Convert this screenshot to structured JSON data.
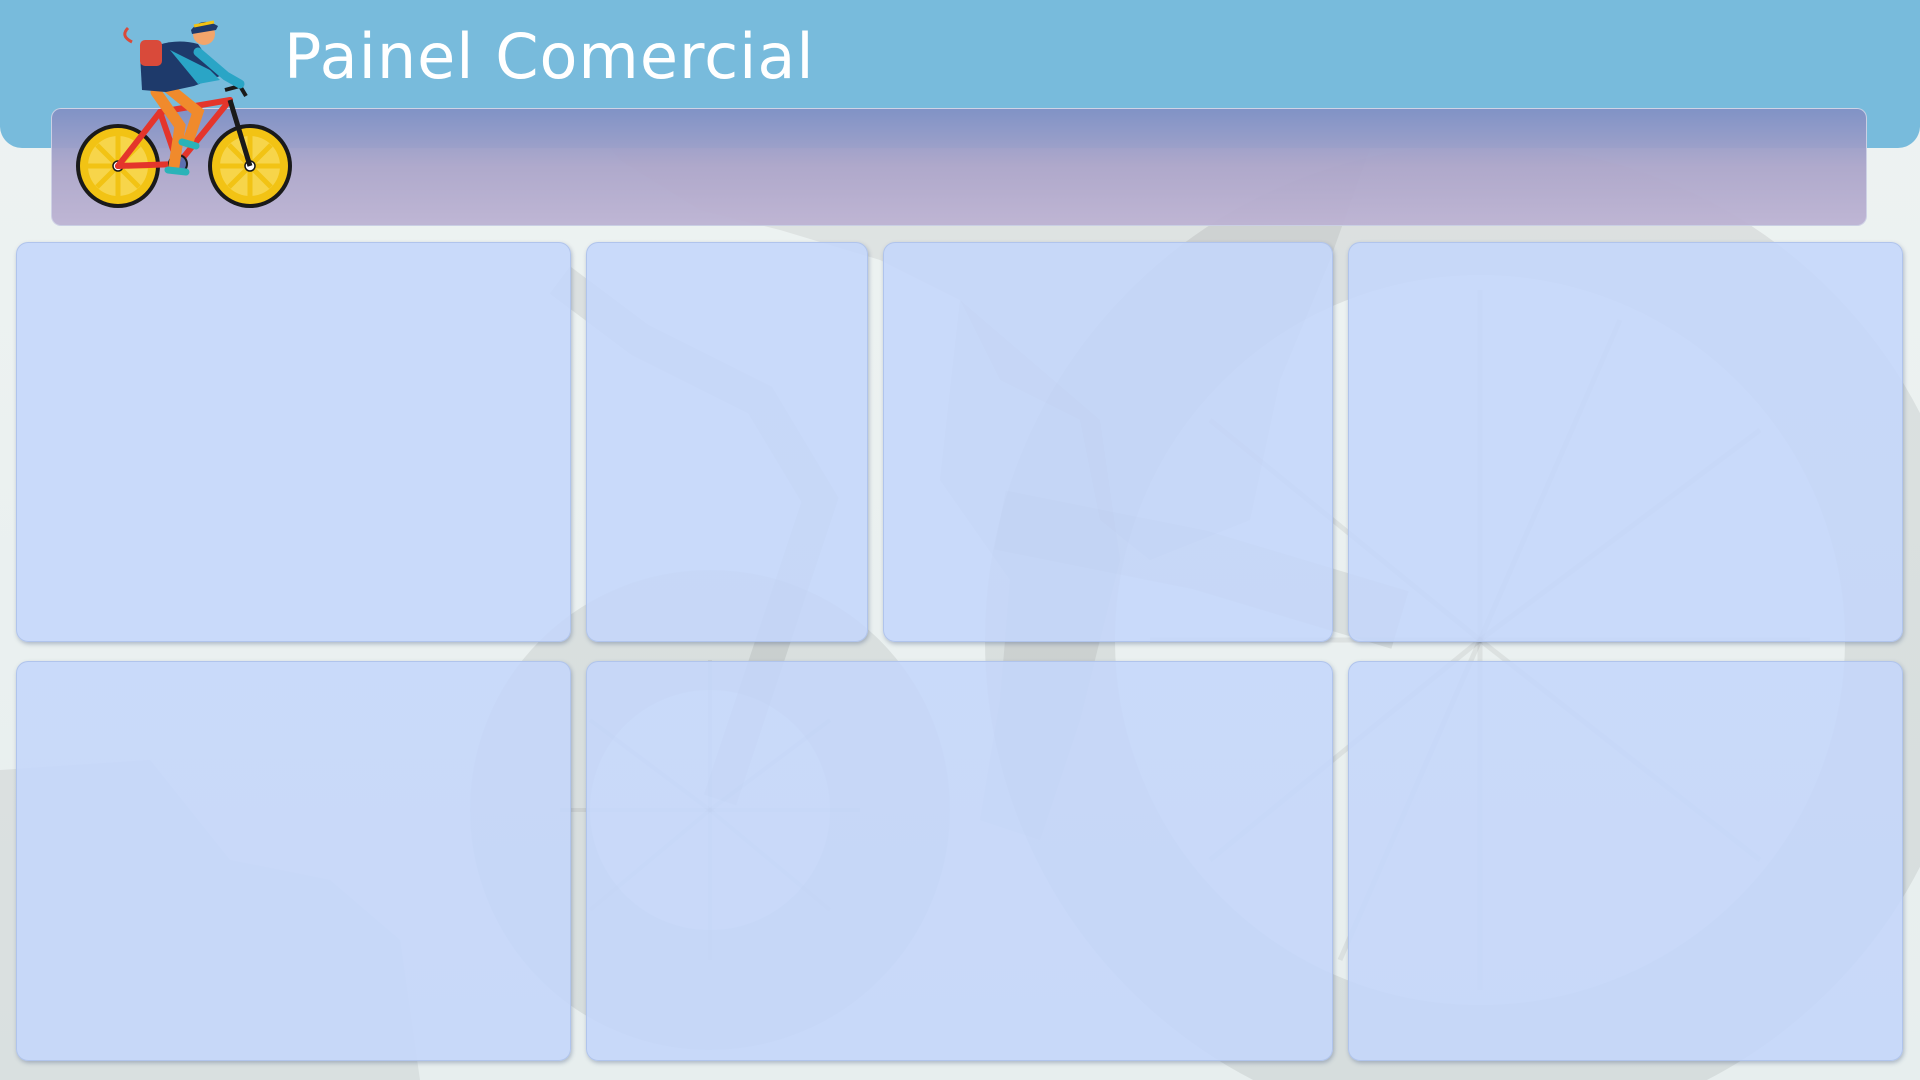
{
  "header": {
    "title": "Painel Comercial"
  },
  "colors": {
    "header_band": "#78bbdc",
    "filter_bar": "#a9a6c9",
    "card": "#c4d6fa",
    "page_background": "#ecf1f0"
  },
  "icons": {
    "logo": "cyclist-logo-icon",
    "watermark": "bicycle-watermark-icon"
  },
  "cards": [
    {
      "id": "card-1"
    },
    {
      "id": "card-2"
    },
    {
      "id": "card-3"
    },
    {
      "id": "card-4"
    },
    {
      "id": "card-5"
    },
    {
      "id": "card-6"
    },
    {
      "id": "card-7"
    }
  ]
}
